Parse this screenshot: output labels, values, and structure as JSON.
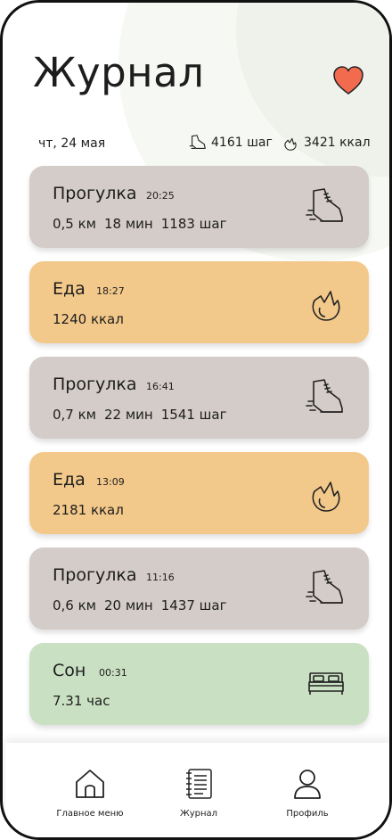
{
  "header": {
    "title": "Журнал",
    "date": "чт, 24 мая",
    "steps_total": "4161 шаг",
    "kcal_total": "3421 ккал"
  },
  "entries": [
    {
      "type": "walk",
      "title": "Прогулка",
      "time": "20:25",
      "details": [
        "0,5 км",
        "18 мин",
        "1183 шаг"
      ],
      "icon": "sneaker-icon"
    },
    {
      "type": "food",
      "title": "Еда",
      "time": "18:27",
      "details": [
        "1240 ккал"
      ],
      "icon": "flame-icon"
    },
    {
      "type": "walk",
      "title": "Прогулка",
      "time": "16:41",
      "details": [
        "0,7 км",
        "22 мин",
        "1541 шаг"
      ],
      "icon": "sneaker-icon"
    },
    {
      "type": "food",
      "title": "Еда",
      "time": "13:09",
      "details": [
        "2181 ккал"
      ],
      "icon": "flame-icon"
    },
    {
      "type": "walk",
      "title": "Прогулка",
      "time": "11:16",
      "details": [
        "0,6 км",
        "20 мин",
        "1437 шаг"
      ],
      "icon": "sneaker-icon"
    },
    {
      "type": "sleep",
      "title": "Сон",
      "time": "00:31",
      "details": [
        "7.31 час"
      ],
      "icon": "bed-icon"
    }
  ],
  "tabs": [
    {
      "label": "Главное меню",
      "icon": "home-icon"
    },
    {
      "label": "Журнал",
      "icon": "journal-icon"
    },
    {
      "label": "Профиль",
      "icon": "profile-icon"
    }
  ],
  "colors": {
    "walk": "#d3ccc8",
    "food": "#f3c98b",
    "sleep": "#c9e0c2",
    "heart": "#f26b4f"
  }
}
